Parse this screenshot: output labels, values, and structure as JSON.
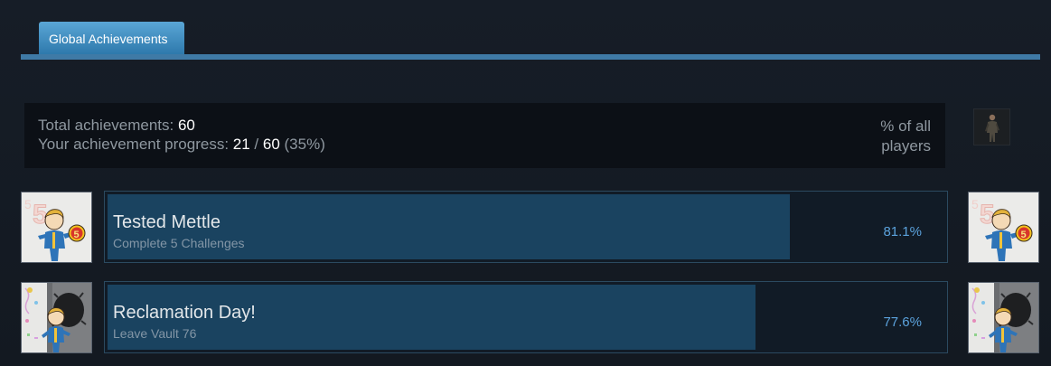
{
  "tabs": [
    {
      "label": "Global Achievements",
      "active": true
    }
  ],
  "summary": {
    "total_label": "Total achievements: ",
    "total_value": "60",
    "progress_label": "Your achievement progress: ",
    "progress_unlocked": "21",
    "progress_sep": " / ",
    "progress_total": "60",
    "progress_percent": " (35%)",
    "percent_header_line1": "% of all",
    "percent_header_line2": "players"
  },
  "achievements": [
    {
      "title": "Tested Mettle",
      "description": "Complete 5 Challenges",
      "percent_label": "81.1%",
      "percent": 81.1,
      "icon": "vault-boy-five-medal-icon"
    },
    {
      "title": "Reclamation Day!",
      "description": "Leave Vault 76",
      "percent_label": "77.6%",
      "percent": 77.6,
      "icon": "vault-boy-vault-door-icon"
    }
  ],
  "colors": {
    "background": "#141a23",
    "tab_accent": "#3f7aa6",
    "bar_fill": "#1a4360",
    "percent_text": "#5ba2dc"
  }
}
